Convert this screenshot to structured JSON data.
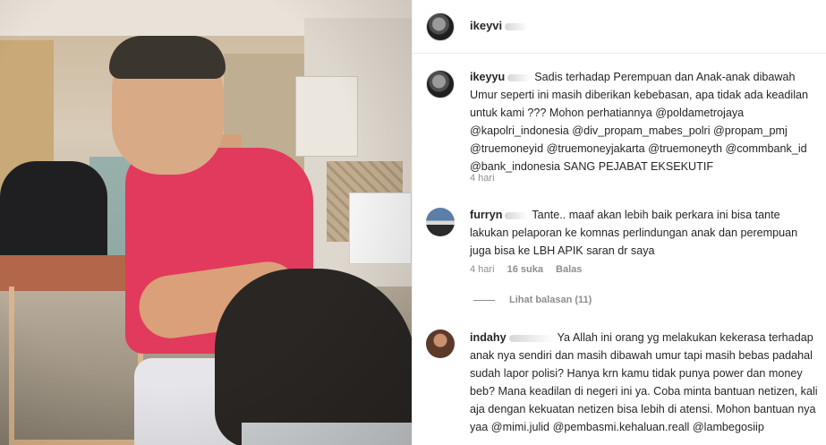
{
  "post": {
    "author": "ikeyvi",
    "author_avatar_icon": "profile-avatar"
  },
  "comments": [
    {
      "username": "ikeyyu",
      "avatar_icon": "profile-avatar",
      "text_line1": "Sadis terhadap Perempuan dan Anak-anak dibawah",
      "text_rest": "Umur seperti ini masih diberikan kebebasan, apa tidak ada keadilan untuk kami ??? Mohon perhatiannya @poldametrojaya @kapolri_indonesia @div_propam_mabes_polri @propam_pmj @truemoneyid @truemoneyjakarta @truemoneyth @commbank_id @bank_indonesia SANG PEJABAT EKSEKUTIF",
      "time": "4 hari"
    },
    {
      "username": "furryn",
      "avatar_icon": "profile-avatar",
      "text_line1": "Tante.. maaf akan lebih baik perkara ini bisa tante",
      "text_rest": "lakukan pelaporan ke komnas perlindungan anak dan perempuan juga bisa ke LBH APIK saran dr saya",
      "time": "4 hari",
      "likes": "16 suka",
      "reply_label": "Balas",
      "view_replies": "Lihat balasan (11)"
    },
    {
      "username": "indahy",
      "avatar_icon": "profile-avatar",
      "text_line1": "Ya Allah ini orang yg melakukan kekerasa",
      "text_rest": "terhadap anak nya sendiri dan masih dibawah umur tapi masih bebas padahal sudah lapor polisi? Hanya krn kamu tidak punya power dan money beb? Mana keadilan di negeri ini ya. Coba minta bantuan netizen, kali aja dengan kekuatan netizen bisa lebih di atensi. Mohon bantuan nya yaa @mimi.julid @pembasmi.kehaluan.reall @lambegosiip"
    }
  ],
  "colors": {
    "text": "#262626",
    "meta": "#8e8e8e",
    "border": "#efefef"
  }
}
